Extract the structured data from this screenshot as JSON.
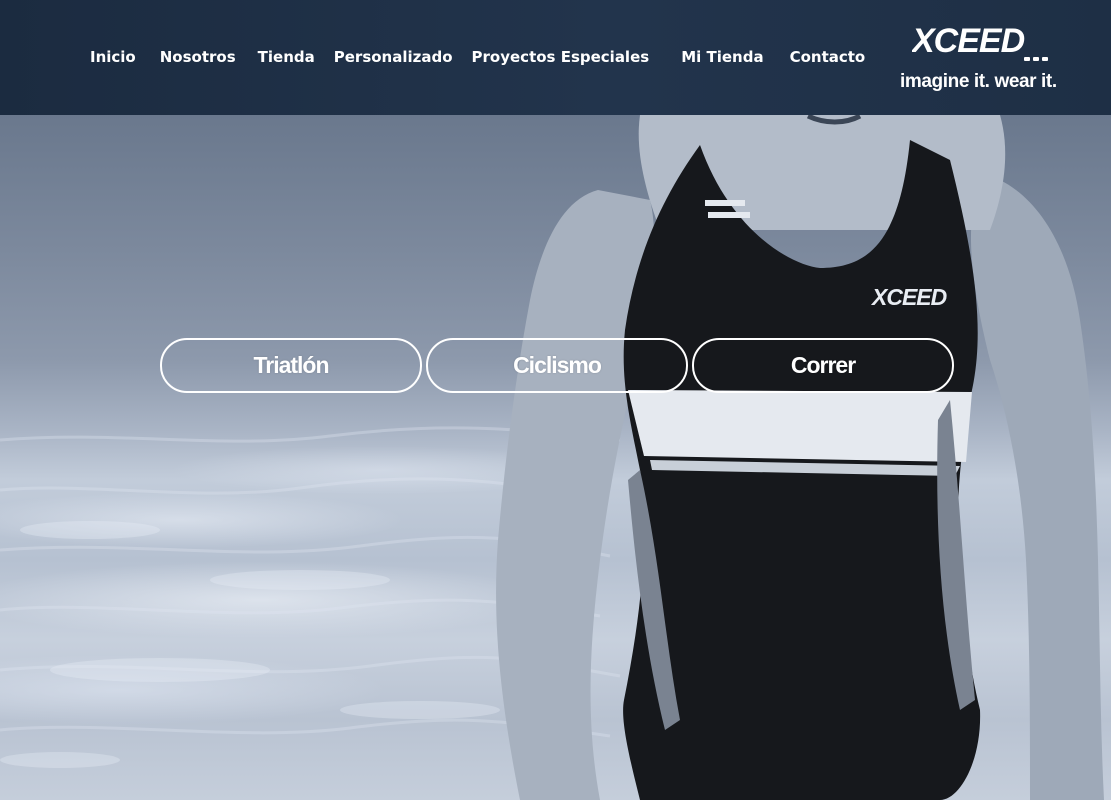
{
  "nav": {
    "items": [
      {
        "label": "Inicio"
      },
      {
        "label": "Nosotros"
      },
      {
        "label": "Tienda"
      },
      {
        "label": "Personalizado"
      },
      {
        "label": "Proyectos Especiales"
      },
      {
        "label": "Mi Tienda"
      },
      {
        "label": "Contacto"
      }
    ]
  },
  "brand": {
    "logo_text": "XCEED",
    "tagline": "imagine it. wear it.",
    "suit_logo_text": "XCEED"
  },
  "categories": [
    {
      "label": "Triatlón"
    },
    {
      "label": "Ciclismo"
    },
    {
      "label": "Correr"
    }
  ],
  "colors": {
    "header_bg": "#1e2f45",
    "nav_text": "#ffffff",
    "button_border": "#ffffff",
    "button_text": "#ffffff"
  }
}
